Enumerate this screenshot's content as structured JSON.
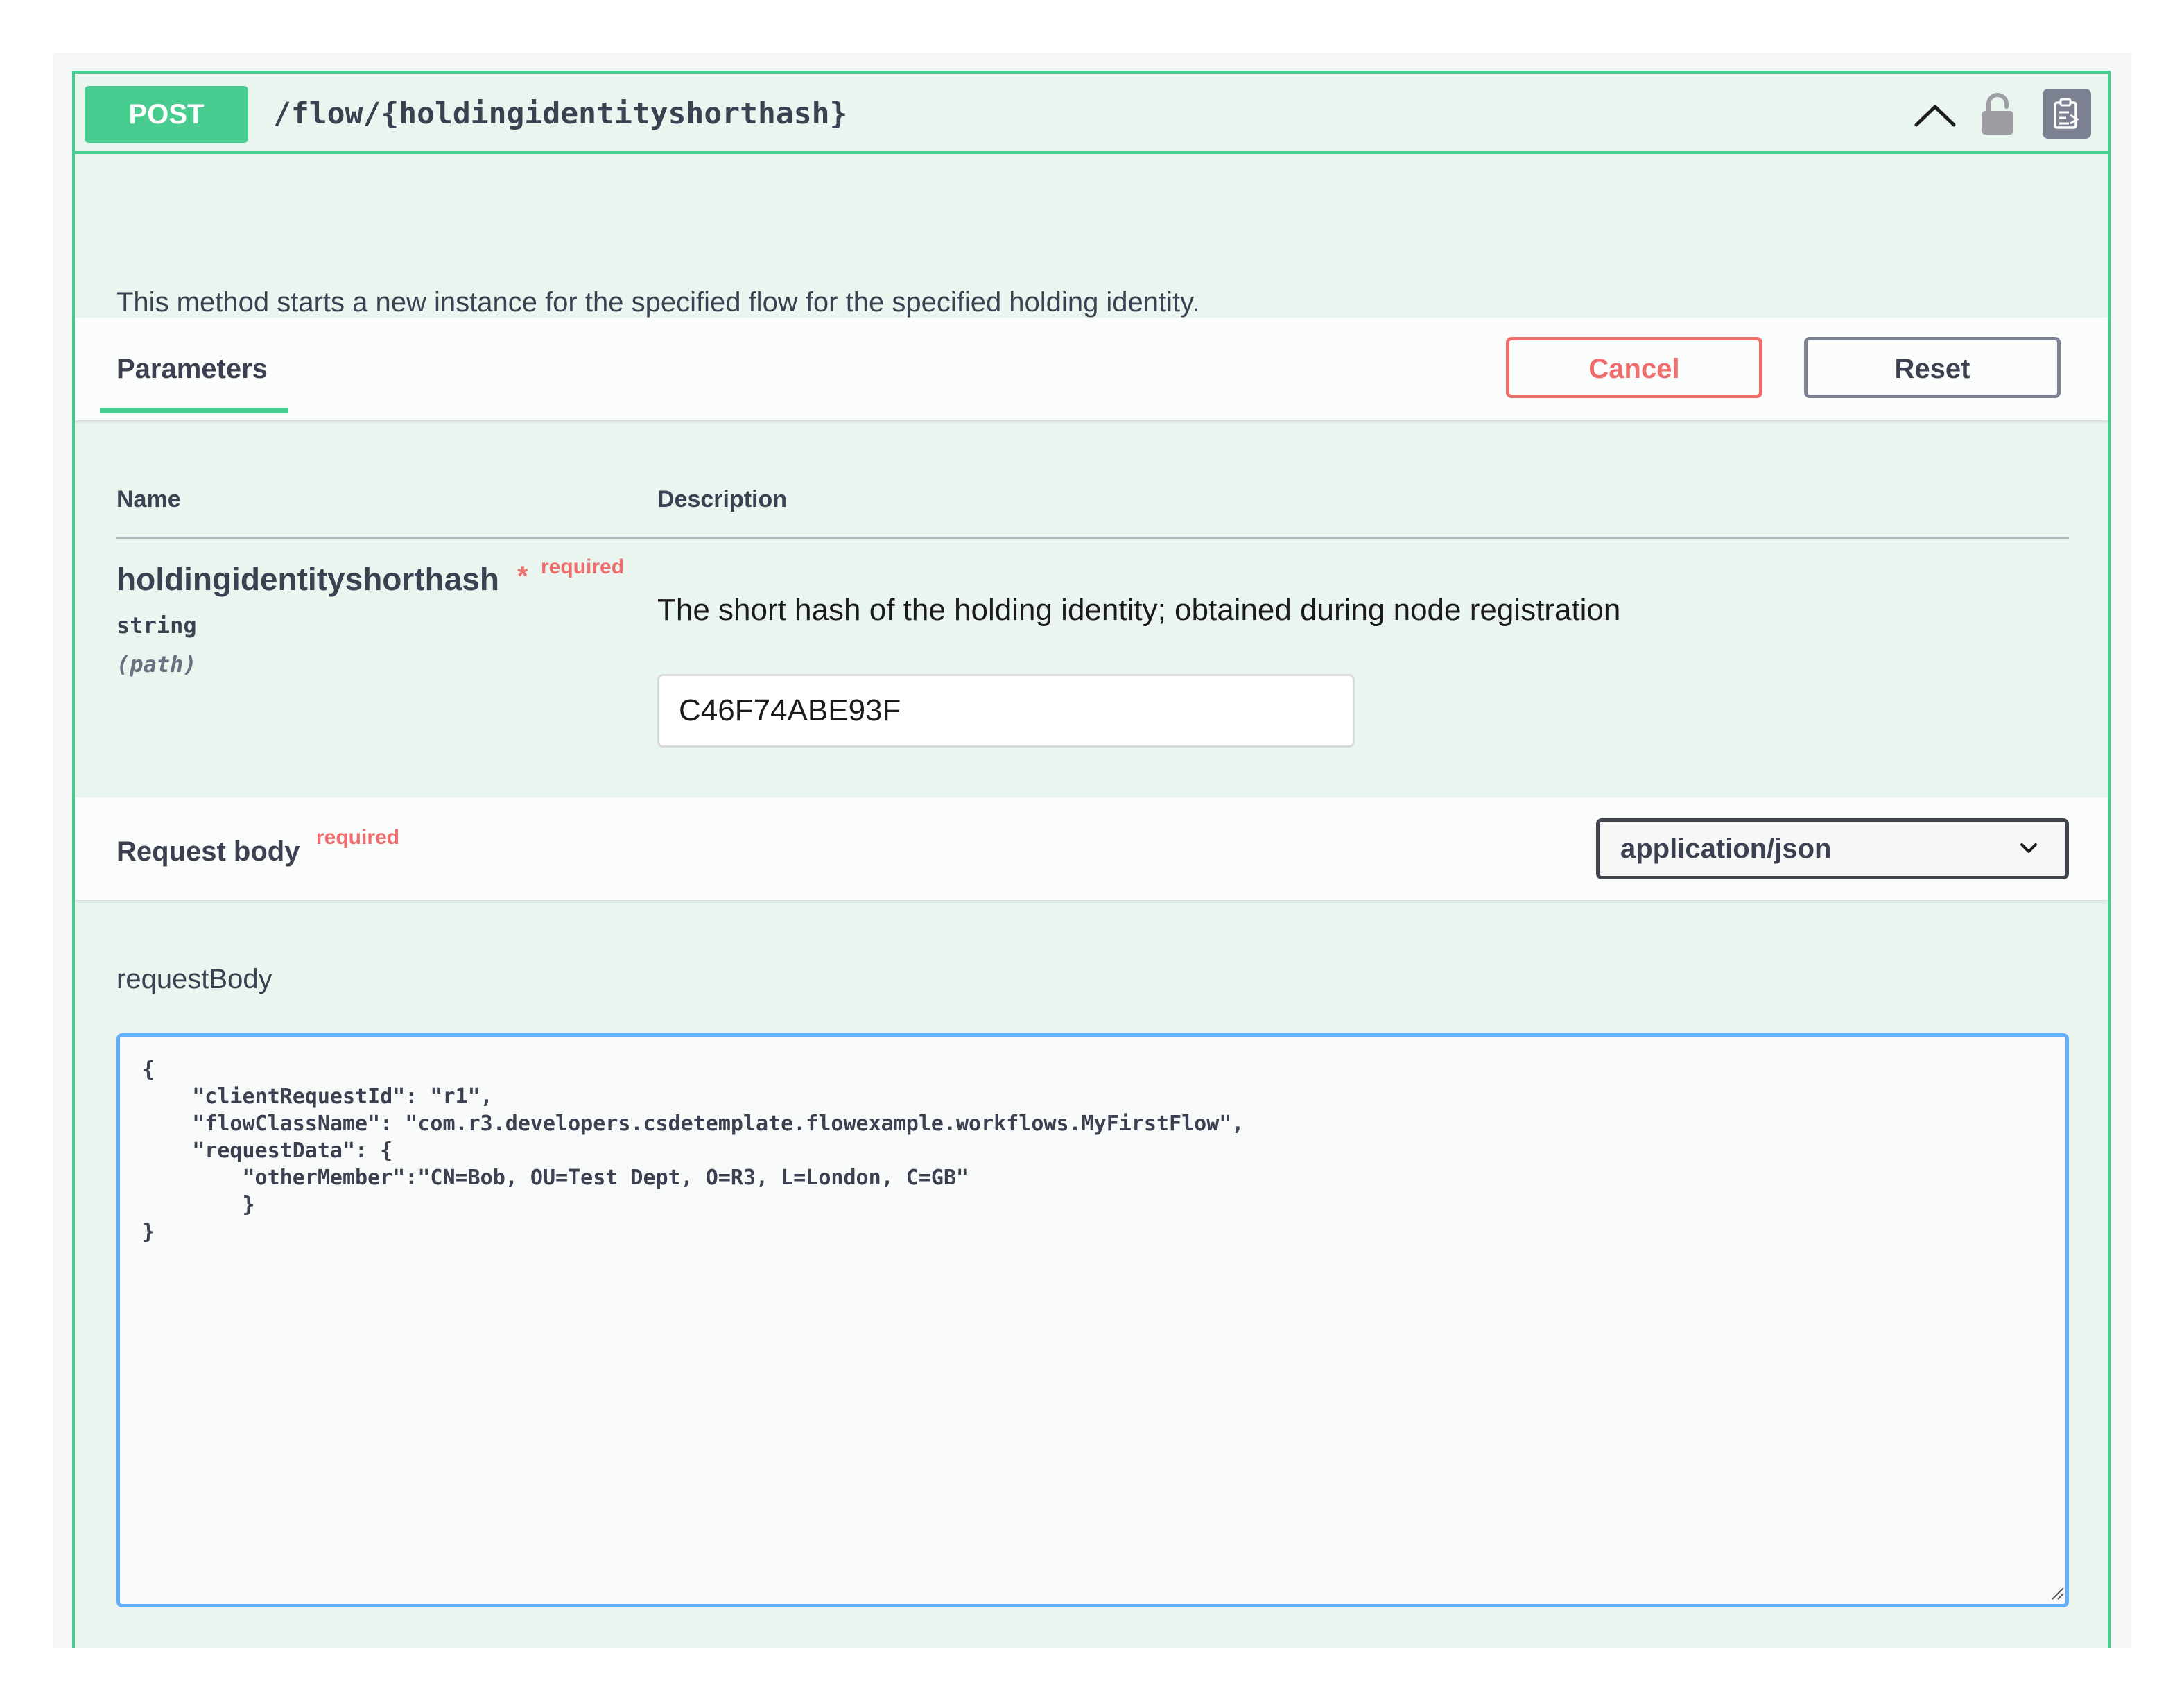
{
  "operation": {
    "method": "POST",
    "path": "/flow/{holdingidentityshorthash}",
    "description": "This method starts a new instance for the specified flow for the specified holding identity.",
    "method_color": "#49cc90",
    "icons": [
      "chevron-up-icon",
      "lock-icon",
      "copy-icon"
    ]
  },
  "parameters": {
    "tab_label": "Parameters",
    "cancel_label": "Cancel",
    "reset_label": "Reset",
    "col_name": "Name",
    "col_description": "Description",
    "items": [
      {
        "name": "holdingidentityshorthash",
        "required_star": "*",
        "required_label": "required",
        "type": "string",
        "in": "(path)",
        "description": "The short hash of the holding identity; obtained during node registration",
        "value": "C46F74ABE93F"
      }
    ]
  },
  "request_body": {
    "title": "Request body",
    "required_label": "required",
    "content_type": "application/json",
    "label": "requestBody",
    "text": "{\n    \"clientRequestId\": \"r1\",\n    \"flowClassName\": \"com.r3.developers.csdetemplate.flowexample.workflows.MyFirstFlow\",\n    \"requestData\": {\n        \"otherMember\":\"CN=Bob, OU=Test Dept, O=R3, L=London, C=GB\"\n        }\n}"
  },
  "colors": {
    "accent": "#49cc90",
    "danger": "#f06d6d",
    "editor_border": "#61affe"
  }
}
